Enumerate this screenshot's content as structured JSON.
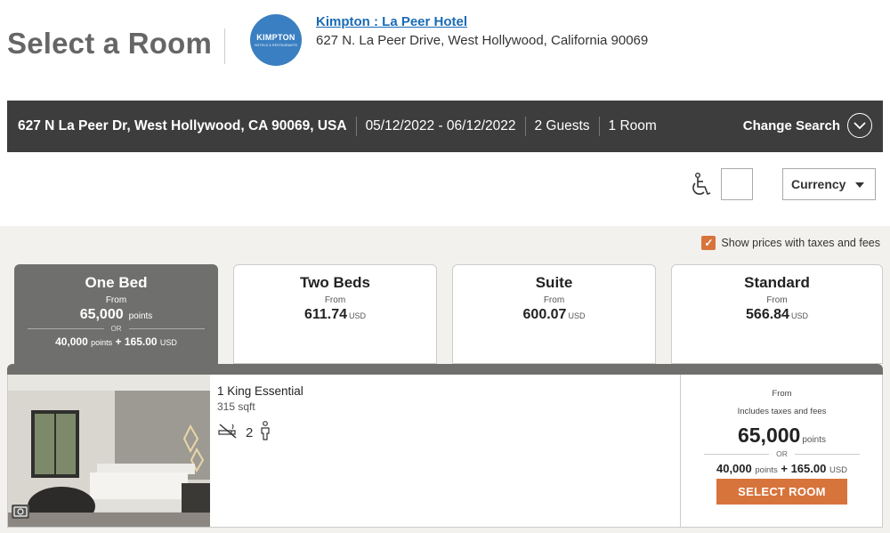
{
  "header": {
    "page_title": "Select a Room",
    "logo_text": "KIMPTON",
    "logo_subtext": "HOTELS & RESTAURANTS",
    "hotel_name": "Kimpton : La Peer Hotel",
    "hotel_address": "627 N. La Peer Drive, West Hollywood, California 90069"
  },
  "search": {
    "location": "627 N La Peer Dr, West Hollywood, CA 90069, USA",
    "dates": "05/12/2022 - 06/12/2022",
    "guests": "2 Guests",
    "rooms": "1 Room",
    "change_label": "Change Search"
  },
  "filters": {
    "currency_label": "Currency",
    "tax_label": "Show prices with taxes and fees",
    "tax_checked": true
  },
  "tabs": [
    {
      "name": "One Bed",
      "from": "From",
      "price": "65,000",
      "unit": "points",
      "or": "OR",
      "alt_points": "40,000",
      "alt_points_unit": "points",
      "alt_plus": "+ 165.00",
      "alt_currency": "USD",
      "active": true
    },
    {
      "name": "Two Beds",
      "from": "From",
      "price": "611.74",
      "unit": "USD",
      "active": false
    },
    {
      "name": "Suite",
      "from": "From",
      "price": "600.07",
      "unit": "USD",
      "active": false
    },
    {
      "name": "Standard",
      "from": "From",
      "price": "566.84",
      "unit": "USD",
      "active": false
    }
  ],
  "room": {
    "name": "1 King Essential",
    "size": "315 sqft",
    "occupancy": "2",
    "price_from": "From",
    "price_note": "Includes taxes and fees",
    "points": "65,000",
    "points_unit": "points",
    "or": "OR",
    "alt_points": "40,000",
    "alt_points_unit": "points",
    "alt_plus": "+ 165.00",
    "alt_currency": "USD",
    "select_label": "SELECT ROOM"
  },
  "colors": {
    "accent": "#d7743c",
    "dark_bar": "#3d3d3d",
    "active_tab": "#6f706e",
    "link": "#1a6bb5",
    "logo": "#3a7fc1"
  }
}
